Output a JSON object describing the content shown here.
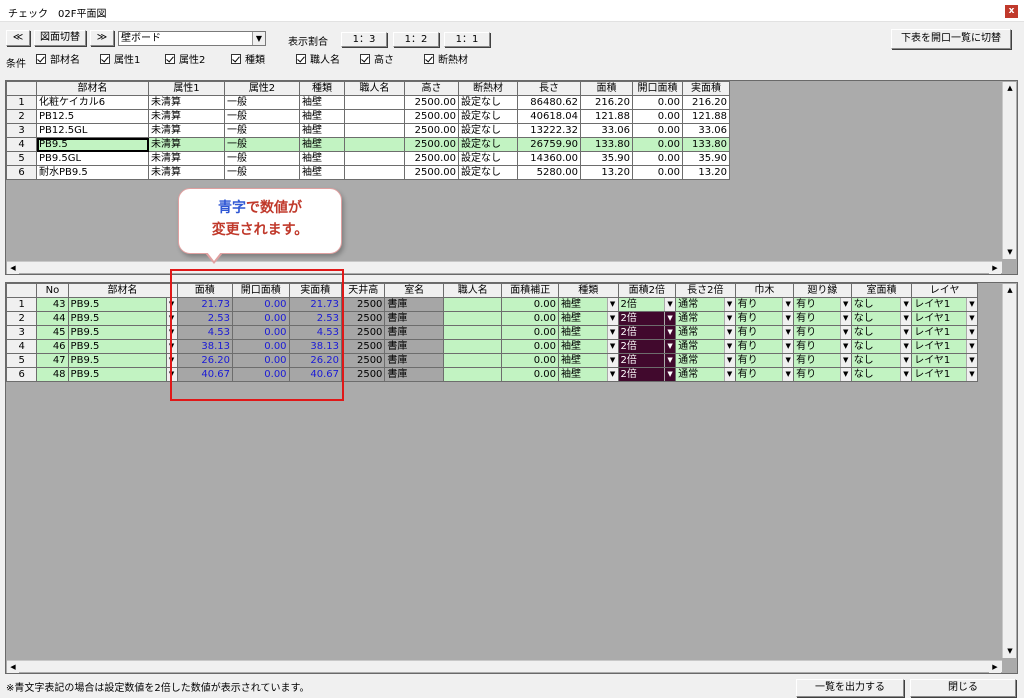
{
  "window": {
    "title": "チェック　02F平面図",
    "close": "x"
  },
  "toolbar": {
    "prev": "≪",
    "toggle_view": "図面切替",
    "next": "≫",
    "category": "壁ボード",
    "ratio_label": "表示割合",
    "ratio_options": [
      "1：3",
      "1：2",
      "1：1"
    ],
    "switch_button": "下表を開口一覧に切替"
  },
  "conditions": {
    "label": "条件",
    "items": [
      "部材名",
      "属性1",
      "属性2",
      "種類",
      "職人名",
      "高さ",
      "断熱材"
    ]
  },
  "upper_table": {
    "headers": [
      "部材名",
      "属性1",
      "属性2",
      "種類",
      "職人名",
      "高さ",
      "断熱材",
      "長さ",
      "面積",
      "開口面積",
      "実面積"
    ],
    "rows": [
      {
        "n": "1",
        "name": "化粧ケイカル6",
        "a1": "未清算",
        "a2": "一般",
        "kind": "袖壁",
        "worker": "",
        "height": "2500.00",
        "ins": "設定なし",
        "len": "86480.62",
        "area": "216.20",
        "open": "0.00",
        "real": "216.20"
      },
      {
        "n": "2",
        "name": "PB12.5",
        "a1": "未清算",
        "a2": "一般",
        "kind": "袖壁",
        "worker": "",
        "height": "2500.00",
        "ins": "設定なし",
        "len": "40618.04",
        "area": "121.88",
        "open": "0.00",
        "real": "121.88"
      },
      {
        "n": "3",
        "name": "PB12.5GL",
        "a1": "未清算",
        "a2": "一般",
        "kind": "袖壁",
        "worker": "",
        "height": "2500.00",
        "ins": "設定なし",
        "len": "13222.32",
        "area": "33.06",
        "open": "0.00",
        "real": "33.06"
      },
      {
        "n": "4",
        "name": "PB9.5",
        "a1": "未清算",
        "a2": "一般",
        "kind": "袖壁",
        "worker": "",
        "height": "2500.00",
        "ins": "設定なし",
        "len": "26759.90",
        "area": "133.80",
        "open": "0.00",
        "real": "133.80"
      },
      {
        "n": "5",
        "name": "PB9.5GL",
        "a1": "未清算",
        "a2": "一般",
        "kind": "袖壁",
        "worker": "",
        "height": "2500.00",
        "ins": "設定なし",
        "len": "14360.00",
        "area": "35.90",
        "open": "0.00",
        "real": "35.90"
      },
      {
        "n": "6",
        "name": "耐水PB9.5",
        "a1": "未清算",
        "a2": "一般",
        "kind": "袖壁",
        "worker": "",
        "height": "2500.00",
        "ins": "設定なし",
        "len": "5280.00",
        "area": "13.20",
        "open": "0.00",
        "real": "13.20"
      }
    ]
  },
  "callout": {
    "line1_a": "青字",
    "line1_b": "で数値が",
    "line2": "変更されます。"
  },
  "lower_table": {
    "headers": [
      "No",
      "部材名",
      "面積",
      "開口面積",
      "実面積",
      "天井高",
      "室名",
      "職人名",
      "面積補正",
      "種類",
      "面積2倍",
      "長さ2倍",
      "巾木",
      "廻り縁",
      "室面積",
      "レイヤ"
    ],
    "rows": [
      {
        "n": "1",
        "no": "43",
        "name": "PB9.5",
        "area": "21.73",
        "open": "0.00",
        "real": "21.73",
        "ceil": "2500",
        "room": "書庫",
        "worker": "",
        "corr": "0.00",
        "kind": "袖壁",
        "d2": "2倍",
        "l2": "通常",
        "hab": "有り",
        "mawa": "有り",
        "room_area": "なし",
        "layer": "レイヤ1"
      },
      {
        "n": "2",
        "no": "44",
        "name": "PB9.5",
        "area": "2.53",
        "open": "0.00",
        "real": "2.53",
        "ceil": "2500",
        "room": "書庫",
        "worker": "",
        "corr": "0.00",
        "kind": "袖壁",
        "d2": "2倍",
        "l2": "通常",
        "hab": "有り",
        "mawa": "有り",
        "room_area": "なし",
        "layer": "レイヤ1"
      },
      {
        "n": "3",
        "no": "45",
        "name": "PB9.5",
        "area": "4.53",
        "open": "0.00",
        "real": "4.53",
        "ceil": "2500",
        "room": "書庫",
        "worker": "",
        "corr": "0.00",
        "kind": "袖壁",
        "d2": "2倍",
        "l2": "通常",
        "hab": "有り",
        "mawa": "有り",
        "room_area": "なし",
        "layer": "レイヤ1"
      },
      {
        "n": "4",
        "no": "46",
        "name": "PB9.5",
        "area": "38.13",
        "open": "0.00",
        "real": "38.13",
        "ceil": "2500",
        "room": "書庫",
        "worker": "",
        "corr": "0.00",
        "kind": "袖壁",
        "d2": "2倍",
        "l2": "通常",
        "hab": "有り",
        "mawa": "有り",
        "room_area": "なし",
        "layer": "レイヤ1"
      },
      {
        "n": "5",
        "no": "47",
        "name": "PB9.5",
        "area": "26.20",
        "open": "0.00",
        "real": "26.20",
        "ceil": "2500",
        "room": "書庫",
        "worker": "",
        "corr": "0.00",
        "kind": "袖壁",
        "d2": "2倍",
        "l2": "通常",
        "hab": "有り",
        "mawa": "有り",
        "room_area": "なし",
        "layer": "レイヤ1"
      },
      {
        "n": "6",
        "no": "48",
        "name": "PB9.5",
        "area": "40.67",
        "open": "0.00",
        "real": "40.67",
        "ceil": "2500",
        "room": "書庫",
        "worker": "",
        "corr": "0.00",
        "kind": "袖壁",
        "d2": "2倍",
        "l2": "通常",
        "hab": "有り",
        "mawa": "有り",
        "room_area": "なし",
        "layer": "レイヤ1"
      }
    ]
  },
  "footer": {
    "note": "※青文字表記の場合は設定数値を2倍した数値が表示されています。",
    "export_button": "一覧を出力する",
    "close_button": "閉じる"
  },
  "colors": {
    "highlight_row": "#c2f3c2",
    "value_blue": "#1a1ad6",
    "dark_cell": "#41092d",
    "callout_border": "#e01818"
  },
  "icons": {
    "scroll_left": "◀",
    "scroll_right": "▶",
    "scroll_up": "▲",
    "scroll_down": "▼",
    "dropdown": "▼"
  }
}
